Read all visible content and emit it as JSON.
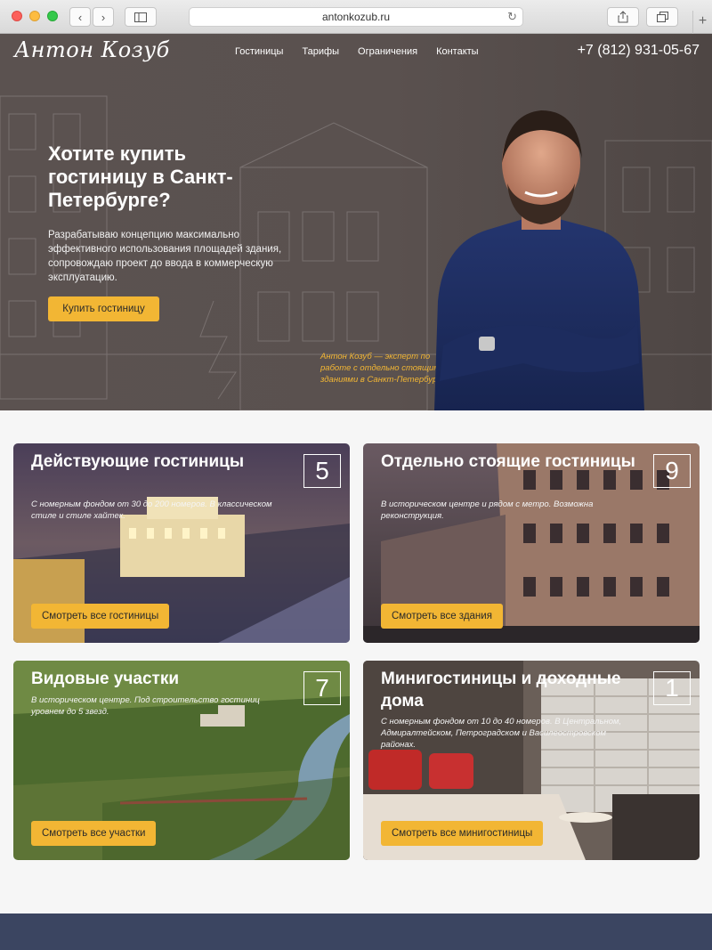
{
  "browser": {
    "url": "antonkozub.ru",
    "icons": [
      "back-icon",
      "forward-icon",
      "sidebar-icon",
      "reload-icon",
      "share-icon",
      "tabs-icon",
      "new-tab-icon"
    ]
  },
  "nav": {
    "logo": "Антон Козуб",
    "items": [
      "Гостиницы",
      "Тарифы",
      "Ограничения",
      "Контакты"
    ],
    "phone": "+7 (812) 931-05-67"
  },
  "hero": {
    "title": "Хотите купить гостиницу в Санкт-Петербурге?",
    "description": "Разрабатываю концепцию максимально эффективного использования площадей здания, сопровождаю проект до ввода в коммерческую эксплуатацию.",
    "button": "Купить гостиницу",
    "caption": "Антон Козуб — эксперт по работе с отдельно стоящими зданиями в Санкт-Петербурге"
  },
  "cards": [
    {
      "title": "Действующие гостиницы",
      "count": "5",
      "subtitle": "С номерным фондом от 30 до 200 номеров. В классическом стиле и стиле хайтек.",
      "button": "Смотреть все гостиницы"
    },
    {
      "title": "Отдельно стоящие гостиницы",
      "count": "9",
      "subtitle": "В историческом центре и рядом с метро. Возможна реконструкция.",
      "button": "Смотреть все здания"
    },
    {
      "title": "Видовые участки",
      "count": "7",
      "subtitle": "В историческом центре. Под строительство гостиниц уровнем до 5 звезд.",
      "button": "Смотреть все участки"
    },
    {
      "title": "Миниостиницы и доходные дома",
      "title_display": "Минигостиницы и доходные дома",
      "count": "1",
      "subtitle": "С номерным фондом от 10 до 40 номеров. В Центральном, Адмиралтейском, Петроградском и Василеостровском районах.",
      "button": "Смотреть все минигостиницы"
    }
  ],
  "colors": {
    "accent": "#f2b634",
    "hero_bg": "#5a514f",
    "footer": "#3b4561"
  }
}
